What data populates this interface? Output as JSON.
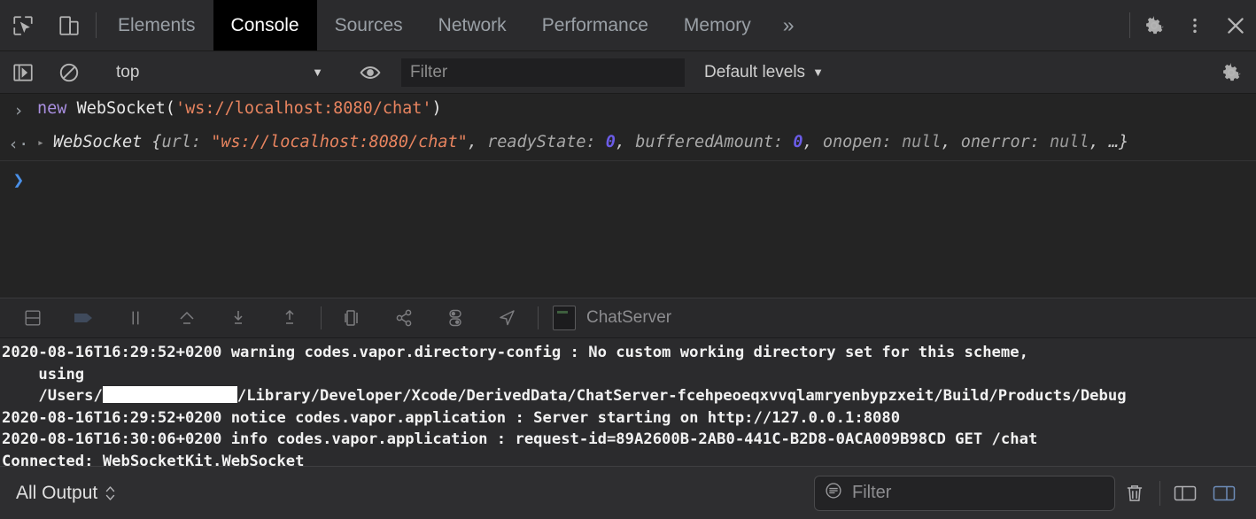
{
  "devtools": {
    "icons": {
      "inspect": "cursor-inspect-icon",
      "device": "device-toggle-icon",
      "settings": "gear-icon",
      "kebab": "more-vertical-icon",
      "close": "close-icon"
    },
    "tabs": [
      {
        "label": "Elements",
        "active": false
      },
      {
        "label": "Console",
        "active": true
      },
      {
        "label": "Sources",
        "active": false
      },
      {
        "label": "Network",
        "active": false
      },
      {
        "label": "Performance",
        "active": false
      },
      {
        "label": "Memory",
        "active": false
      }
    ],
    "more_tabs_label": "»",
    "filterbar": {
      "context_value": "top",
      "caret": "▼",
      "eye_icon": "eye-icon",
      "filter_placeholder": "Filter",
      "filter_value": "",
      "levels_label": "Default levels",
      "levels_caret": "▼",
      "settings_icon": "gear-icon"
    }
  },
  "console": {
    "input_gutter": "›",
    "output_gutter": "‹·",
    "prompt_gutter": "❯",
    "expand_arrow": "▸",
    "entries": [
      {
        "type": "input",
        "tokens": [
          {
            "t": "new ",
            "k": "kw"
          },
          {
            "t": "WebSocket(",
            "k": "plain"
          },
          {
            "t": "'ws://localhost:8080/chat'",
            "k": "str"
          },
          {
            "t": ")",
            "k": "plain"
          }
        ]
      },
      {
        "type": "output",
        "class_name": "WebSocket",
        "tokens": [
          {
            "t": " {",
            "k": "punc"
          },
          {
            "t": "url: ",
            "k": "prop"
          },
          {
            "t": "\"ws://localhost:8080/chat\"",
            "k": "str"
          },
          {
            "t": ", ",
            "k": "punc"
          },
          {
            "t": "readyState: ",
            "k": "prop"
          },
          {
            "t": "0",
            "k": "num"
          },
          {
            "t": ", ",
            "k": "punc"
          },
          {
            "t": "bufferedAmount: ",
            "k": "prop"
          },
          {
            "t": "0",
            "k": "num"
          },
          {
            "t": ", ",
            "k": "punc"
          },
          {
            "t": "onopen: ",
            "k": "prop"
          },
          {
            "t": "null",
            "k": "null"
          },
          {
            "t": ", ",
            "k": "punc"
          },
          {
            "t": "onerror: ",
            "k": "prop"
          },
          {
            "t": "null",
            "k": "null"
          },
          {
            "t": ", ",
            "k": "punc"
          },
          {
            "t": "…}",
            "k": "punc"
          }
        ]
      }
    ]
  },
  "xcode": {
    "debugbar": {
      "buttons": [
        "hide-console-icon",
        "step-over-breakpoint-icon",
        "pause-resume-icon",
        "step-over-icon",
        "step-into-icon",
        "step-out-icon",
        "debug-view-hierarchy-icon",
        "debug-memory-graph-icon",
        "environment-overrides-icon",
        "simulate-location-icon"
      ],
      "scheme_label": "ChatServer",
      "app_icon": "app-icon"
    },
    "log_lines": [
      {
        "id": "line1",
        "segments": [
          {
            "text": "2020-08-16T16:29:52+0200 warning codes.vapor.directory-config : No custom working directory set for this scheme,",
            "redacted": false
          },
          {
            "text": "\n    using\n    /Users/",
            "redacted": false
          },
          {
            "text": "",
            "redacted": true
          },
          {
            "text": "/Library/Developer/Xcode/DerivedData/ChatServer-fcehpeoeqxvvqlamryenbypzxeit/Build/Products/Debug",
            "redacted": false
          }
        ]
      },
      {
        "id": "line2",
        "segments": [
          {
            "text": "2020-08-16T16:29:52+0200 notice codes.vapor.application : Server starting on http://127.0.0.1:8080",
            "redacted": false
          }
        ]
      },
      {
        "id": "line3",
        "segments": [
          {
            "text": "2020-08-16T16:30:06+0200 info codes.vapor.application : request-id=89A2600B-2AB0-441C-B2D8-0ACA009B98CD GET /chat",
            "redacted": false
          }
        ]
      },
      {
        "id": "line4",
        "segments": [
          {
            "text": "Connected: WebSocketKit.WebSocket",
            "redacted": false
          }
        ]
      }
    ],
    "statusbar": {
      "scope_label": "All Output",
      "scope_stepper": "stepper-icon",
      "filter_placeholder": "Filter",
      "filter_value": "",
      "filter_icon": "filter-lines-icon",
      "trash_icon": "trash-icon",
      "split_left_icon": "show-debug-area-icon",
      "split_right_icon": "show-console-icon"
    }
  },
  "colors": {
    "devtools_bg": "#2b2b2d",
    "console_bg": "#242424",
    "active_tab_bg": "#000000",
    "accent_blue": "#4a90e8",
    "string_orange": "#e8845f",
    "keyword_purple": "#a98fe0",
    "number_purple": "#6b5ce7"
  }
}
